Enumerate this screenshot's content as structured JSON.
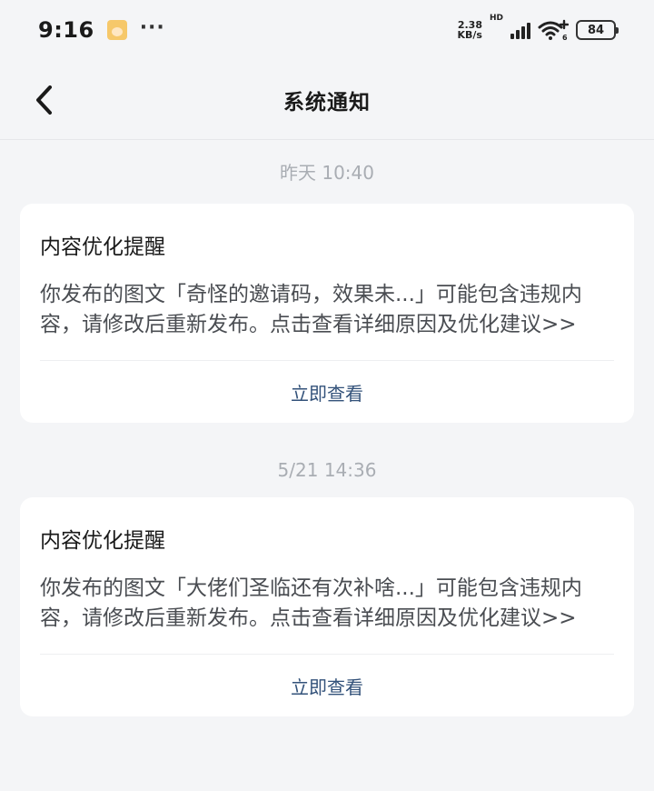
{
  "status_bar": {
    "time": "9:16",
    "more": "···",
    "net_speed_value": "2.38",
    "net_speed_unit": "KB/s",
    "hd": "HD",
    "battery": "84"
  },
  "header": {
    "title": "系统通知"
  },
  "notifications": [
    {
      "timestamp": "昨天  10:40",
      "title": "内容优化提醒",
      "body": "你发布的图文「奇怪的邀请码，效果未...」可能包含违规内容，请修改后重新发布。点击查看详细原因及优化建议>>",
      "action": "立即查看"
    },
    {
      "timestamp": "5/21  14:36",
      "title": "内容优化提醒",
      "body": "你发布的图文「大佬们圣临还有次补啥...」可能包含违规内容，请修改后重新发布。点击查看详细原因及优化建议>>",
      "action": "立即查看"
    }
  ],
  "colors": {
    "background": "#f4f5f7",
    "card": "#ffffff",
    "action_link": "#33527a",
    "timestamp": "#a9adb3"
  }
}
